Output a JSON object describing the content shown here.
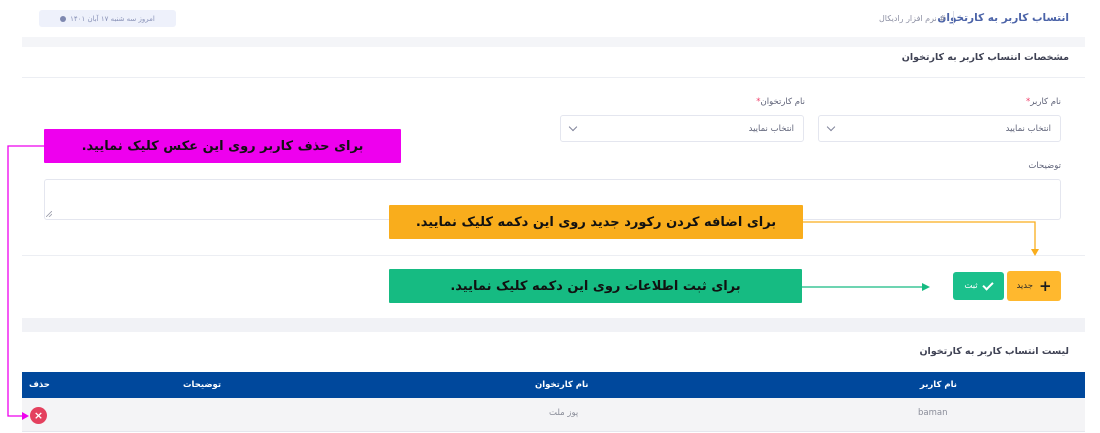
{
  "header": {
    "title": "انتساب کاربر به کارتخوان",
    "breadcrumb": "# نرم افزار رادیکال",
    "date_text": "امروز سه شنبه ۱۷ آبان ۱۴۰۱"
  },
  "form": {
    "section_title": "مشخصات انتساب کاربر به کارتخوان",
    "user_label": "نام کاربر",
    "user_value": "انتخاب نمایید",
    "cardreader_label": "نام کارتخوان",
    "cardreader_value": "انتخاب نمایید",
    "required_mark": "*",
    "description_label": "توضیحات",
    "description_value": ""
  },
  "buttons": {
    "new_label": "جدید",
    "save_label": "ثبت"
  },
  "list": {
    "title": "لیست انتساب کاربر به کارتخوان",
    "columns": [
      "نام کاربر",
      "نام کارتخوان",
      "توضیحات",
      "حذف"
    ],
    "rows": [
      {
        "user": "baman",
        "cardreader": "پوز ملت",
        "description": ""
      }
    ]
  },
  "callouts": {
    "delete": "برای حذف کاربر روی این عکس کلیک نمایید.",
    "new": "برای اضافه کردن رکورد جدید روی این دکمه کلیک نمایید.",
    "save": "برای ثبت اطلاعات روی این دکمه کلیک نمایید."
  },
  "colors": {
    "accent_blue": "#00489c",
    "new_button": "#ffb82e",
    "save_button": "#1bc08c",
    "delete_icon": "#e4405e",
    "callout_magenta": "#ee00ee",
    "callout_yellow": "#f9ad1c",
    "callout_green": "#16bb82"
  }
}
